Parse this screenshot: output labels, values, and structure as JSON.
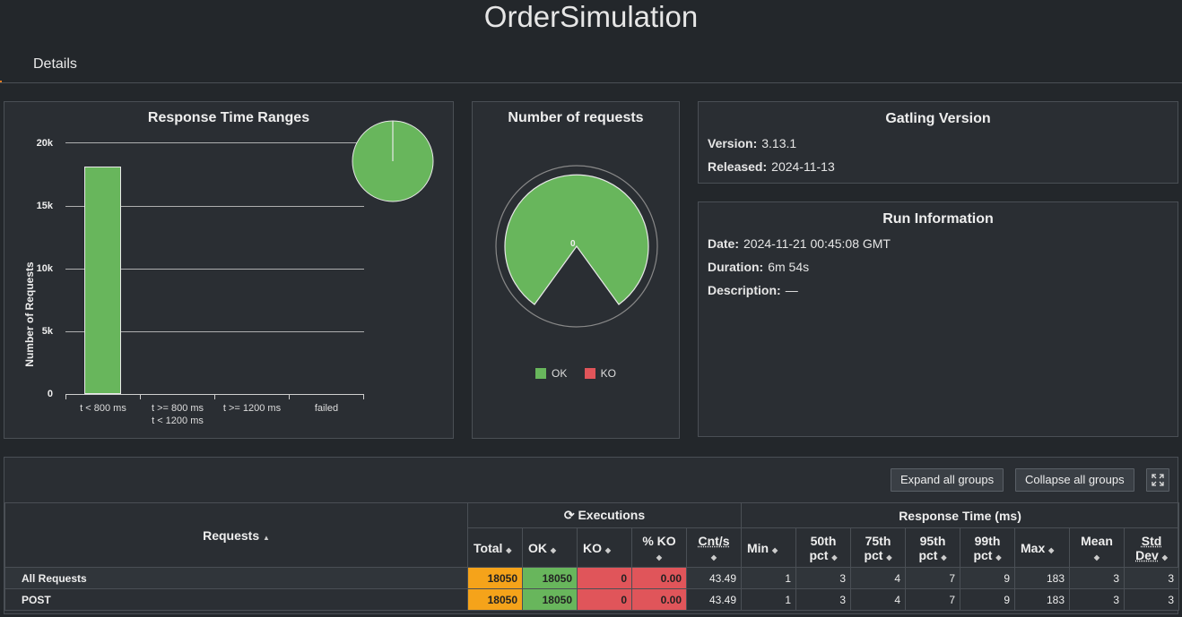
{
  "header": {
    "title": "OrderSimulation"
  },
  "tabs": {
    "details": "Details"
  },
  "ranges_panel": {
    "title": "Response Time Ranges",
    "ylabel": "Number of Requests",
    "yticks": [
      "20k",
      "15k",
      "10k",
      "5k",
      "0"
    ],
    "xticks": [
      "t < 800 ms",
      "t >= 800 ms",
      "t < 1200 ms",
      "t >= 1200 ms",
      "failed"
    ]
  },
  "count_panel": {
    "title": "Number of requests",
    "center_label": "0",
    "legend": {
      "ok": "OK",
      "ko": "KO"
    }
  },
  "chart_data": [
    {
      "type": "bar",
      "title": "Response Time Ranges",
      "ylabel": "Number of Requests",
      "categories": [
        "t < 800 ms",
        "t >= 800 ms t < 1200 ms",
        "t >= 1200 ms",
        "failed"
      ],
      "values": [
        18050,
        0,
        0,
        0
      ],
      "ylim": [
        0,
        20000
      ],
      "grid": true
    },
    {
      "type": "pie",
      "title": "Number of requests",
      "categories": [
        "OK",
        "KO"
      ],
      "values": [
        18050,
        0
      ],
      "colors": [
        "#68b65c",
        "#e0555a"
      ]
    }
  ],
  "gatling": {
    "title": "Gatling Version",
    "version_label": "Version:",
    "version": "3.13.1",
    "released_label": "Released:",
    "released": "2024-11-13"
  },
  "run": {
    "title": "Run Information",
    "date_label": "Date:",
    "date": "2024-11-21 00:45:08 GMT",
    "duration_label": "Duration:",
    "duration": "6m 54s",
    "description_label": "Description:",
    "description": "—"
  },
  "toolbar": {
    "expand": "Expand all groups",
    "collapse": "Collapse all groups",
    "fullscreen_icon": "expand-arrows-icon"
  },
  "table": {
    "requests_header": "Requests",
    "executions_header": "Executions",
    "response_time_header": "Response Time (ms)",
    "columns": {
      "total": "Total",
      "ok": "OK",
      "ko": "KO",
      "pko": "% KO",
      "cnts": "Cnt/s",
      "min": "Min",
      "p50a": "50th",
      "p50b": "pct",
      "p75a": "75th",
      "p75b": "pct",
      "p95a": "95th",
      "p95b": "pct",
      "p99a": "99th",
      "p99b": "pct",
      "max": "Max",
      "mean": "Mean",
      "stda": "Std",
      "stdb": "Dev"
    },
    "rows": [
      {
        "name": "All Requests",
        "total": "18050",
        "ok": "18050",
        "ko": "0",
        "pko": "0.00",
        "cnts": "43.49",
        "min": "1",
        "p50": "3",
        "p75": "4",
        "p95": "7",
        "p99": "9",
        "max": "183",
        "mean": "3",
        "std": "3"
      },
      {
        "name": "POST",
        "total": "18050",
        "ok": "18050",
        "ko": "0",
        "pko": "0.00",
        "cnts": "43.49",
        "min": "1",
        "p50": "3",
        "p75": "4",
        "p95": "7",
        "p99": "9",
        "max": "183",
        "mean": "3",
        "std": "3"
      }
    ]
  },
  "colors": {
    "ok": "#68b65c",
    "ko": "#e0555a",
    "total": "#f5a31a",
    "background": "#23272b"
  }
}
